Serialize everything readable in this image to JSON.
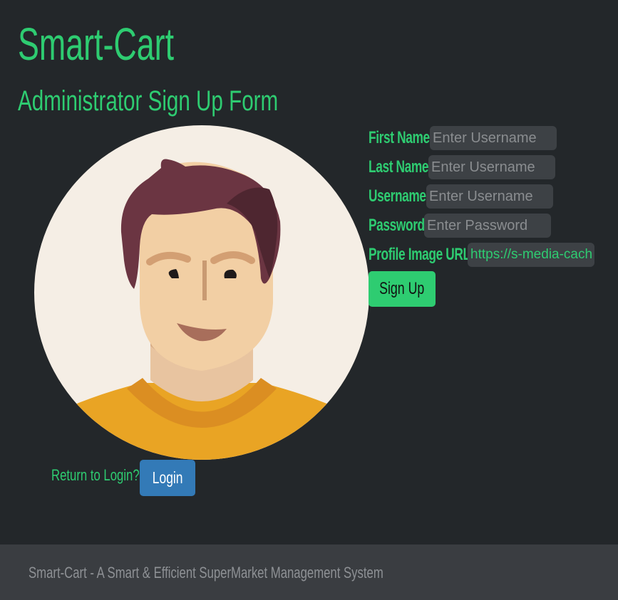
{
  "header": {
    "brand": "Smart-Cart",
    "form_title": "Administrator Sign Up Form"
  },
  "avatar": {
    "icon": "male-user-avatar-icon",
    "colors": {
      "background": "#f5eee5",
      "hair": "#6b3542",
      "skin": "#f2cfa4",
      "shirt": "#e9a424"
    }
  },
  "form": {
    "fields": [
      {
        "label": "First Name:",
        "placeholder": "Enter Username",
        "value": ""
      },
      {
        "label": "Last Name:",
        "placeholder": "Enter Username",
        "value": ""
      },
      {
        "label": "Username:",
        "placeholder": "Enter Username",
        "value": ""
      },
      {
        "label": "Password:",
        "placeholder": "Enter Password",
        "value": ""
      },
      {
        "label": "Profile Image URL:",
        "placeholder": "",
        "value": "https://s-media-cache-ak"
      }
    ],
    "signup_label": "Sign Up"
  },
  "login": {
    "prompt": "Return to Login?",
    "button_label": "Login"
  },
  "footer": {
    "text": "Smart-Cart - A Smart & Efficient SuperMarket Management System"
  },
  "colors": {
    "background": "#23272a",
    "accent": "#2ecc71",
    "input_bg": "#3d4145",
    "login_button": "#337ab7",
    "footer_bg": "#3a3d41",
    "footer_text": "#8e9195"
  }
}
